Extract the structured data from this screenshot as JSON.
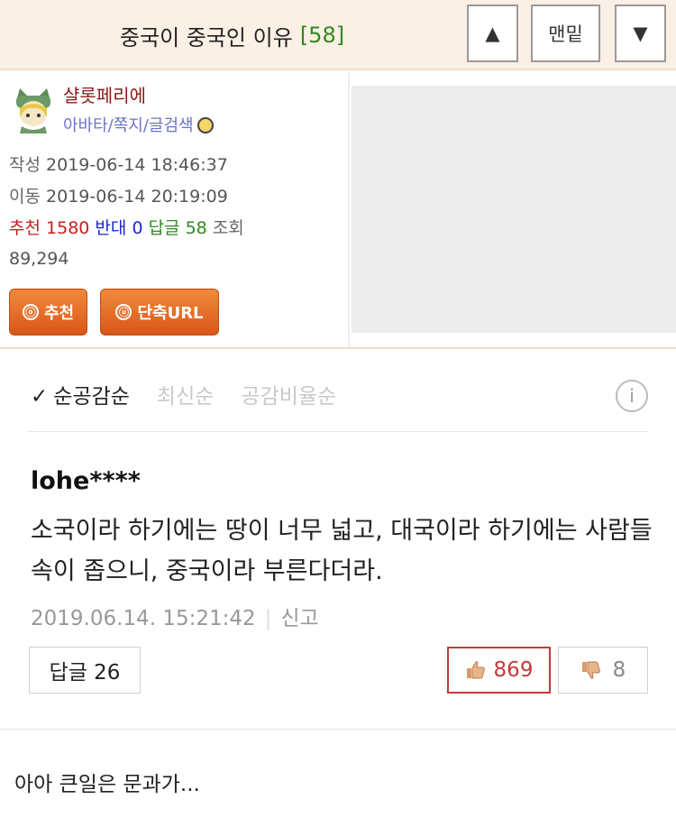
{
  "header": {
    "title": "중국이 중국인 이유",
    "reply_count": "[58]",
    "up_label": "▲",
    "bottom_label": "맨밑",
    "down_label": "▼"
  },
  "author": {
    "nickname": "샬롯페리에",
    "links": "아바타/쪽지/글검색"
  },
  "meta": {
    "written_label": "작성",
    "written": "2019-06-14 18:46:37",
    "moved_label": "이동",
    "moved": "2019-06-14 20:19:09",
    "recommend_label": "추천",
    "recommend": "1580",
    "oppose_label": "반대",
    "oppose": "0",
    "reply_label": "답글",
    "reply": "58",
    "views_label": "조회",
    "views": "89,294"
  },
  "actions": {
    "recommend_icon": "ⓞ",
    "recommend": "추천",
    "shorturl_icon": "ⓤ",
    "shorturl": "단축URL"
  },
  "sort": {
    "check": "✓",
    "options": [
      "순공감순",
      "최신순",
      "공감비율순"
    ],
    "info_icon": "i"
  },
  "comment": {
    "user": "lohe****",
    "text": "소국이라 하기에는 땅이 너무 넓고, 대국이라 하기에는 사람들 속이 좁으니, 중국이라 부른다더라.",
    "date": "2019.06.14. 15:21:42",
    "separator": "|",
    "report": "신고",
    "reply_label": "답글 26",
    "likes": "869",
    "dislikes": "8"
  },
  "body": {
    "text": "아아 큰일은 문과가..."
  },
  "colors": {
    "header_bg": "#fbf0e6",
    "nick": "#8b1a1a",
    "link": "#6b73c8",
    "recommend": "#c81e1e",
    "oppose": "#1a27c4",
    "reply": "#2f8a1e",
    "orange_button": "#e56f28",
    "like": "#c23b3b"
  }
}
